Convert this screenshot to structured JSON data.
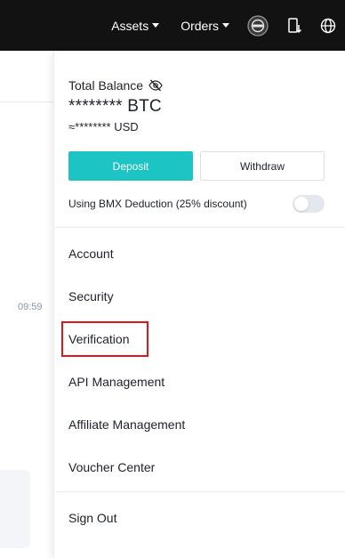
{
  "nav": {
    "assets_label": "Assets",
    "orders_label": "Orders"
  },
  "background": {
    "timestamp_fragment": "09:59"
  },
  "balance": {
    "title": "Total Balance",
    "btc_value": "******** BTC",
    "usd_value": "≈******** USD"
  },
  "actions": {
    "deposit_label": "Deposit",
    "withdraw_label": "Withdraw"
  },
  "deduction": {
    "label": "Using BMX Deduction (25% discount)",
    "enabled": false
  },
  "menu": {
    "items": [
      {
        "label": "Account"
      },
      {
        "label": "Security"
      },
      {
        "label": "Verification"
      },
      {
        "label": "API Management"
      },
      {
        "label": "Affiliate Management"
      },
      {
        "label": "Voucher Center"
      }
    ],
    "sign_out_label": "Sign Out"
  },
  "colors": {
    "navbar": "#121212",
    "accent": "#1cc4c4",
    "highlight_border": "#e0161d"
  },
  "icons": [
    "avatar-icon",
    "download-app-icon",
    "globe-icon",
    "eye-off-icon"
  ]
}
